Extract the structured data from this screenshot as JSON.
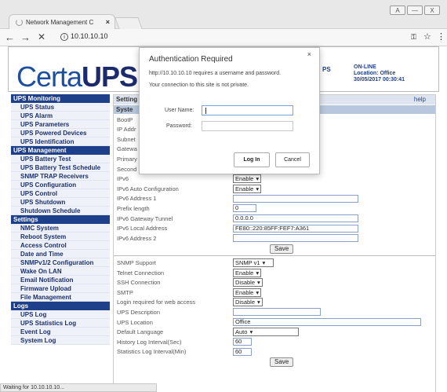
{
  "browser": {
    "tab_title": "Network Management C",
    "tab_close": "×",
    "url": "10.10.10.10",
    "back": "←",
    "forward": "→",
    "reload": "✕",
    "info_icon": "ⓘ",
    "key_icon": "🔑",
    "star_icon": "☆",
    "menu_icon": "⋮",
    "window_user": "A",
    "window_min": "—",
    "window_max": "□",
    "window_close": "X",
    "status": "Waiting for 10.10.10.10..."
  },
  "header": {
    "logo_light": "Certa",
    "logo_bold": "UPS",
    "hidden_ps": "PS",
    "status_line1": "ON-LINE",
    "status_line2": "Location: Office",
    "status_line3": "30/05/2017 00:30:41"
  },
  "sidebar": [
    {
      "type": "section",
      "label": "UPS Monitoring"
    },
    {
      "type": "item",
      "label": "UPS Status"
    },
    {
      "type": "item",
      "label": "UPS Alarm"
    },
    {
      "type": "item",
      "label": "UPS Parameters"
    },
    {
      "type": "item",
      "label": "UPS Powered Devices"
    },
    {
      "type": "item",
      "label": "UPS Identification"
    },
    {
      "type": "section",
      "label": "UPS Management"
    },
    {
      "type": "item",
      "label": "UPS Battery Test"
    },
    {
      "type": "item",
      "label": "UPS Battery Test Schedule"
    },
    {
      "type": "item",
      "label": "SNMP TRAP Receivers"
    },
    {
      "type": "item",
      "label": "UPS Configuration"
    },
    {
      "type": "item",
      "label": "UPS Control"
    },
    {
      "type": "item",
      "label": "UPS Shutdown"
    },
    {
      "type": "item",
      "label": "Shutdown Schedule"
    },
    {
      "type": "section",
      "label": "Settings"
    },
    {
      "type": "item",
      "label": "NMC System"
    },
    {
      "type": "item",
      "label": "Reboot System"
    },
    {
      "type": "item",
      "label": "Access Control"
    },
    {
      "type": "item",
      "label": "Date and Time"
    },
    {
      "type": "item",
      "label": "SNMPv1/2 Configuration"
    },
    {
      "type": "item",
      "label": "Wake On LAN"
    },
    {
      "type": "item",
      "label": "Email Notification"
    },
    {
      "type": "item",
      "label": "Firmware Upload"
    },
    {
      "type": "item",
      "label": "File Management"
    },
    {
      "type": "section",
      "label": "Logs"
    },
    {
      "type": "item",
      "label": "UPS Log"
    },
    {
      "type": "item",
      "label": "UPS Statistics Log"
    },
    {
      "type": "item",
      "label": "Event Log"
    },
    {
      "type": "item",
      "label": "System Log"
    }
  ],
  "main": {
    "title": "Setting",
    "help": "help",
    "section_bar": "Syste",
    "hidden_rows": [
      "BootP",
      "IP Addr",
      "Subnet",
      "Gatewa",
      "Primary",
      "Second"
    ],
    "rows_a": [
      {
        "label": "IPv6",
        "kind": "select",
        "value": "Enable"
      },
      {
        "label": "IPv6 Auto Configuration",
        "kind": "select",
        "value": "Enable"
      },
      {
        "label": "IPv6 Address 1",
        "kind": "input",
        "value": ""
      },
      {
        "label": "Prefix length",
        "kind": "input",
        "value": "0"
      },
      {
        "label": "IPv6 Gateway Tunnel",
        "kind": "input",
        "value": "0.0.0.0"
      },
      {
        "label": "IPv6 Local Address",
        "kind": "input",
        "value": "FE80::220:85FF:FEF7:A361"
      },
      {
        "label": "IPv6 Address 2",
        "kind": "input",
        "value": ""
      }
    ],
    "save_label_1": "Save",
    "rows_b": [
      {
        "label": "SNMP Support",
        "kind": "select",
        "value": "SNMP v1"
      },
      {
        "label": "Telnet Connection",
        "kind": "select",
        "value": "Enable"
      },
      {
        "label": "SSH Connection",
        "kind": "select",
        "value": "Disable"
      },
      {
        "label": "SMTP",
        "kind": "select",
        "value": "Enable"
      },
      {
        "label": "Login required for web access",
        "kind": "select",
        "value": "Disable"
      },
      {
        "label": "UPS Description",
        "kind": "input",
        "value": ""
      },
      {
        "label": "UPS Location",
        "kind": "input",
        "value": "Office"
      },
      {
        "label": "Default Language",
        "kind": "select",
        "value": "Auto"
      },
      {
        "label": "History Log Interval(Sec)",
        "kind": "input",
        "value": "60"
      },
      {
        "label": "Statistics Log Interval(Min)",
        "kind": "input",
        "value": "60"
      }
    ],
    "save_label_2": "Save"
  },
  "dialog": {
    "title": "Authentication Required",
    "close": "×",
    "message1": "http://10.10.10.10 requires a username and password.",
    "message2": "Your connection to this site is not private.",
    "username_label": "User Name:",
    "password_label": "Password:",
    "login_button": "Log In",
    "cancel_button": "Cancel"
  }
}
